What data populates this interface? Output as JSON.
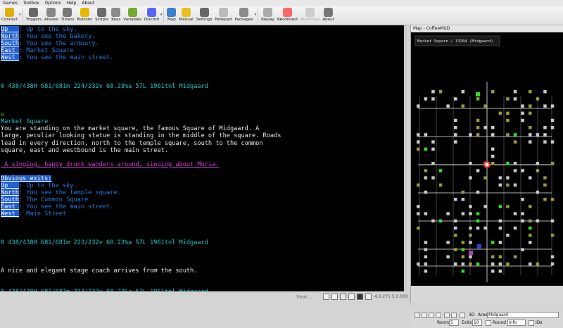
{
  "menu": [
    "Games",
    "Toolbox",
    "Options",
    "Help",
    "About"
  ],
  "toolbar": [
    {
      "label": "Connect",
      "icon": "connect-icon",
      "color": "#e0b000",
      "dd": true
    },
    {
      "label": "Triggers",
      "icon": "triggers-icon",
      "color": "#666666",
      "dd": false
    },
    {
      "label": "Aliases",
      "icon": "aliases-icon",
      "color": "#888888",
      "dd": false
    },
    {
      "label": "Timers",
      "icon": "timers-icon",
      "color": "#777777",
      "dd": false
    },
    {
      "label": "Buttons",
      "icon": "buttons-icon",
      "color": "#e8b800",
      "dd": false
    },
    {
      "label": "Scripts",
      "icon": "scripts-icon",
      "color": "#6a6a6a",
      "dd": false
    },
    {
      "label": "Keys",
      "icon": "keys-icon",
      "color": "#8a8a8a",
      "dd": false
    },
    {
      "label": "Variables",
      "icon": "variables-icon",
      "color": "#77aa33",
      "dd": false
    },
    {
      "label": "Discord",
      "icon": "discord-icon",
      "color": "#5865f2",
      "dd": true
    },
    {
      "label": "Map",
      "icon": "map-icon",
      "color": "#3a7fd0",
      "dd": false
    },
    {
      "label": "Manual",
      "icon": "manual-icon",
      "color": "#e8c020",
      "dd": false
    },
    {
      "label": "Settings",
      "icon": "settings-icon",
      "color": "#666666",
      "dd": false
    },
    {
      "label": "Notepad",
      "icon": "notepad-icon",
      "color": "#bbbbbb",
      "dd": false
    },
    {
      "label": "Packages",
      "icon": "packages-icon",
      "color": "#8a8a8a",
      "dd": true
    },
    {
      "label": "Replay",
      "icon": "replay-icon",
      "color": "#aaaaaa",
      "dd": false
    },
    {
      "label": "Reconnect",
      "icon": "reconnect-icon",
      "color": "#ff6666",
      "dd": false
    },
    {
      "label": "MultiView",
      "icon": "multiview-icon",
      "color": "#cccccc",
      "dd": false,
      "disabled": true
    },
    {
      "label": "About",
      "icon": "about-icon",
      "color": "#777777",
      "dd": false
    }
  ],
  "console_lines": [
    [
      {
        "t": "Up   ",
        "c": "exitlbl"
      },
      {
        "t": ": Up to the sky.",
        "c": "blue"
      }
    ],
    [
      {
        "t": "North",
        "c": "exitlbl"
      },
      {
        "t": ": You see the bakery.",
        "c": "blue"
      }
    ],
    [
      {
        "t": "South",
        "c": "exitlbl"
      },
      {
        "t": ": You see the armoury.",
        "c": "blue"
      }
    ],
    [
      {
        "t": "East ",
        "c": "exitlbl"
      },
      {
        "t": ": Market Square",
        "c": "blue"
      }
    ],
    [
      {
        "t": "West ",
        "c": "exitlbl"
      },
      {
        "t": ": You see the main street.",
        "c": "blue"
      }
    ],
    [],
    [],
    [],
    [
      {
        "t": "0 438/438H 681/681m 224/232v 68.23%a 57L 1961tnl Midgaard",
        "c": "statusline"
      }
    ],
    [],
    [],
    [],
    [
      {
        "t": "e",
        "c": "green"
      }
    ],
    [
      {
        "t": "Market Square",
        "c": "cyan"
      }
    ],
    [
      {
        "t": "You are standing on the market square, the famous Square of Midgaard. A",
        "c": ""
      }
    ],
    [
      {
        "t": "large, peculiar looking statue is standing in the middle of the square. Roads",
        "c": ""
      }
    ],
    [
      {
        "t": "lead in every direction, north to the temple square, south to the common",
        "c": ""
      }
    ],
    [
      {
        "t": "square, east and westbound is the main street.",
        "c": ""
      }
    ],
    [],
    [
      {
        "t": " A singing, happy drunk wanders around, singing about Moria.",
        "c": "magenta"
      }
    ],
    [],
    [
      {
        "t": "Obvious exits:",
        "c": "exitlbl"
      }
    ],
    [
      {
        "t": "Up   ",
        "c": "exitlbl"
      },
      {
        "t": ": Up to the sky.",
        "c": "blue"
      }
    ],
    [
      {
        "t": "North",
        "c": "exitlbl"
      },
      {
        "t": ": You see the temple square.",
        "c": "blue"
      }
    ],
    [
      {
        "t": "South",
        "c": "exitlbl"
      },
      {
        "t": ": The Common Square",
        "c": "blue"
      }
    ],
    [
      {
        "t": "East ",
        "c": "exitlbl"
      },
      {
        "t": ": You see the main street.",
        "c": "blue"
      }
    ],
    [
      {
        "t": "West ",
        "c": "exitlbl"
      },
      {
        "t": ": Main Street",
        "c": "blue"
      }
    ],
    [],
    [],
    [],
    [
      {
        "t": "0 438/438H 681/681m 223/232v 68.23%a 57L 1961tnl Midgaard",
        "c": "statusline"
      }
    ],
    [],
    [],
    [],
    [
      {
        "t": "A nice and elegant stage coach arrives from the south.",
        "c": ""
      }
    ],
    [],
    [],
    [
      {
        "t": "0 438/438H 681/681m 224/232v 68.23%a 57L 1961tnl Midgaard",
        "c": "statusline"
      }
    ]
  ],
  "statusbar": {
    "search_placeholder": "Sear…",
    "version": "4.0.271 5:0.000"
  },
  "map": {
    "window_title": "Map - CoffeeMUD",
    "room_label": "Market Square / 13204 (Midgaard)",
    "area_label": "Area:",
    "area_value": "Midgaard",
    "btn_3d": "3D",
    "rooms_label": "Rooms:",
    "rooms_value": "5",
    "exits_label": "Exits",
    "exits_value": "10",
    "round_label": "Round",
    "info_label": "Info",
    "ids_label": "IDs",
    "colors": {
      "room": "#c8c8c8",
      "room_olive": "#9a9a3a",
      "room_green": "#2ce02c",
      "room_blue": "#3040e0",
      "room_magenta": "#b040b0",
      "current": "#ff3030",
      "link": "#e8e8e8",
      "bg": "#000000"
    }
  }
}
